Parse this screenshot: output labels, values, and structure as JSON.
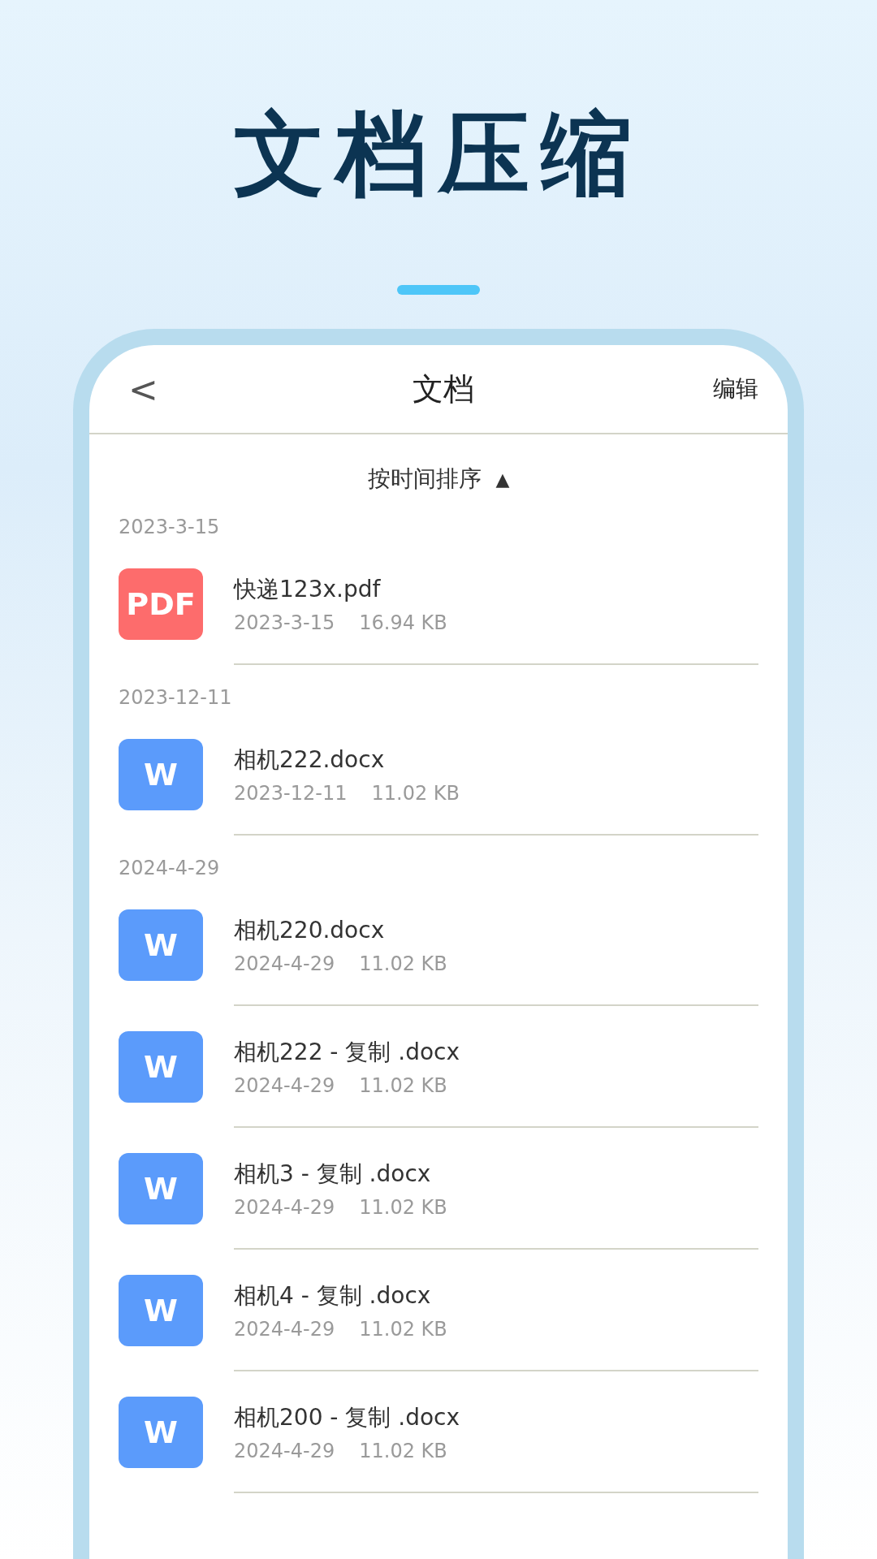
{
  "headline": "文档压缩",
  "top_bar": {
    "back": "<",
    "title": "文档",
    "action": "编辑"
  },
  "sort": {
    "label": "按时间排序",
    "arrow": "▲"
  },
  "groups": [
    {
      "date": "2023-3-15",
      "files": [
        {
          "kind": "pdf",
          "icon_text": "PDF",
          "name": "快递123x.pdf",
          "date": "2023-3-15",
          "size": "16.94 KB"
        }
      ]
    },
    {
      "date": "2023-12-11",
      "files": [
        {
          "kind": "word",
          "icon_text": "W",
          "name": "相机222.docx",
          "date": "2023-12-11",
          "size": "11.02 KB"
        }
      ]
    },
    {
      "date": "2024-4-29",
      "files": [
        {
          "kind": "word",
          "icon_text": "W",
          "name": "相机220.docx",
          "date": "2024-4-29",
          "size": "11.02 KB"
        },
        {
          "kind": "word",
          "icon_text": "W",
          "name": "相机222 - 复制 .docx",
          "date": "2024-4-29",
          "size": "11.02 KB"
        },
        {
          "kind": "word",
          "icon_text": "W",
          "name": "相机3 - 复制 .docx",
          "date": "2024-4-29",
          "size": "11.02 KB"
        },
        {
          "kind": "word",
          "icon_text": "W",
          "name": "相机4 - 复制 .docx",
          "date": "2024-4-29",
          "size": "11.02 KB"
        },
        {
          "kind": "word",
          "icon_text": "W",
          "name": "相机200 - 复制 .docx",
          "date": "2024-4-29",
          "size": "11.02 KB"
        }
      ]
    }
  ]
}
